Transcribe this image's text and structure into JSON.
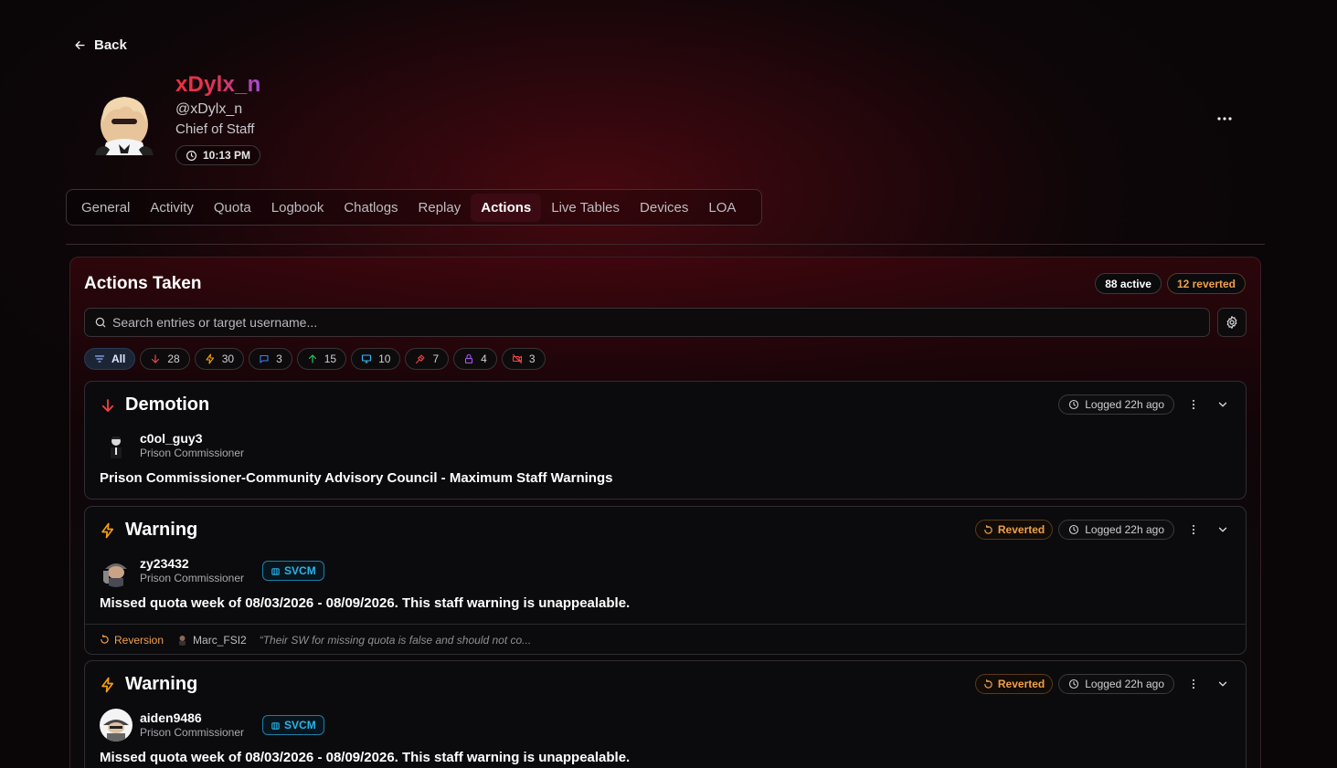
{
  "nav": {
    "back_label": "Back"
  },
  "profile": {
    "display_name": "xDylx_n",
    "handle": "@xDylx_n",
    "role": "Chief of Staff",
    "local_time": "10:13 PM"
  },
  "tabs": [
    {
      "label": "General",
      "active": false
    },
    {
      "label": "Activity",
      "active": false
    },
    {
      "label": "Quota",
      "active": false
    },
    {
      "label": "Logbook",
      "active": false
    },
    {
      "label": "Chatlogs",
      "active": false
    },
    {
      "label": "Replay",
      "active": false
    },
    {
      "label": "Actions",
      "active": true
    },
    {
      "label": "Live Tables",
      "active": false
    },
    {
      "label": "Devices",
      "active": false
    },
    {
      "label": "LOA",
      "active": false
    }
  ],
  "panel": {
    "title": "Actions Taken",
    "active_count": "88 active",
    "reverted_count": "12 reverted",
    "search_placeholder": "Search entries or target username..."
  },
  "filters": [
    {
      "label": "All",
      "icon": "filter-icon",
      "color": "#8fb0ff",
      "selected": true
    },
    {
      "label": "28",
      "icon": "arrow-down-icon",
      "color": "#ef4444",
      "selected": false
    },
    {
      "label": "30",
      "icon": "lightning-icon",
      "color": "#f59e0b",
      "selected": false
    },
    {
      "label": "3",
      "icon": "message-icon",
      "color": "#3b82f6",
      "selected": false
    },
    {
      "label": "15",
      "icon": "arrow-up-icon",
      "color": "#22c55e",
      "selected": false
    },
    {
      "label": "10",
      "icon": "monitor-icon",
      "color": "#38bdf8",
      "selected": false
    },
    {
      "label": "7",
      "icon": "gavel-icon",
      "color": "#ef4444",
      "selected": false
    },
    {
      "label": "4",
      "icon": "lock-icon",
      "color": "#a855f7",
      "selected": false
    },
    {
      "label": "3",
      "icon": "no-camera-icon",
      "color": "#ef4444",
      "selected": false
    }
  ],
  "cards": [
    {
      "type": "Demotion",
      "icon": "arrow-down-icon",
      "icon_color": "#ef4444",
      "logged": "Logged 22h ago",
      "reverted": null,
      "target_name": "c0ol_guy3",
      "target_role": "Prison Commissioner",
      "badge": null,
      "reason": "Prison Commissioner-Community Advisory Council - Maximum Staff Warnings"
    },
    {
      "type": "Warning",
      "icon": "lightning-icon",
      "icon_color": "#f59e0b",
      "logged": "Logged 22h ago",
      "reverted": "Reverted",
      "target_name": "zy23432",
      "target_role": "Prison Commissioner",
      "badge": "SVCM",
      "reason": "Missed quota week of 08/03/2026 - 08/09/2026. This staff warning is unappealable.",
      "reversion": {
        "label": "Reversion",
        "user": "Marc_FSI2",
        "quote": "“Their SW for missing quota is false and should not co..."
      }
    },
    {
      "type": "Warning",
      "icon": "lightning-icon",
      "icon_color": "#f59e0b",
      "logged": "Logged 22h ago",
      "reverted": "Reverted",
      "target_name": "aiden9486",
      "target_role": "Prison Commissioner",
      "badge": "SVCM",
      "reason": "Missed quota week of 08/03/2026 - 08/09/2026. This staff warning is unappealable."
    }
  ]
}
